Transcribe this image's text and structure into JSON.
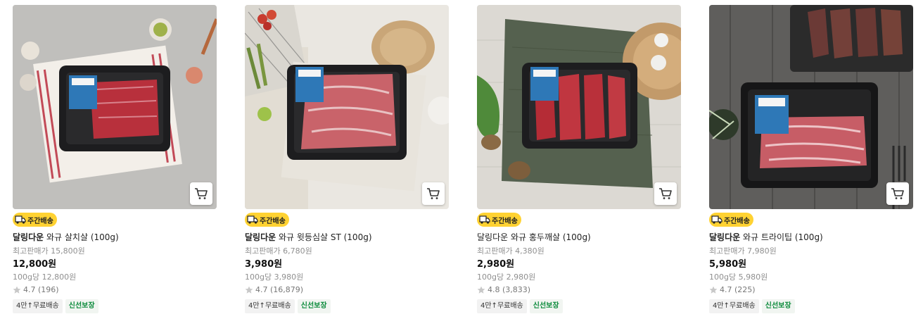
{
  "products": [
    {
      "badge": "주간배송",
      "brand": "달링다운",
      "name": " 와규 살치살 (100g)",
      "orig_price": "최고판매가 15,800원",
      "price": "12,800원",
      "unit_price": "100g당 12,800원",
      "rating": "4.7 (196)",
      "tags": [
        "4만↑무료배송",
        "신선보장"
      ],
      "brand_bold": true
    },
    {
      "badge": "주간배송",
      "brand": "달링다운",
      "name": " 와규 윗등심살 ST (100g)",
      "orig_price": "최고판매가 6,780원",
      "price": "3,980원",
      "unit_price": "100g당 3,980원",
      "rating": "4.7 (16,879)",
      "tags": [
        "4만↑무료배송",
        "신선보장"
      ],
      "brand_bold": true
    },
    {
      "badge": "주간배송",
      "brand": "달링다운",
      "name": " 와규 홍두깨살 (100g)",
      "orig_price": "최고판매가 4,380원",
      "price": "2,980원",
      "unit_price": "100g당 2,980원",
      "rating": "4.8 (3,833)",
      "tags": [
        "4만↑무료배송",
        "신선보장"
      ],
      "brand_bold": false
    },
    {
      "badge": "주간배송",
      "brand": "달링다운",
      "name": " 와규 트라이팁 (100g)",
      "orig_price": "최고판매가 7,980원",
      "price": "5,980원",
      "unit_price": "100g당 5,980원",
      "rating": "4.7 (225)",
      "tags": [
        "4만↑무료배송",
        "신선보장"
      ],
      "brand_bold": true
    }
  ],
  "colors": {
    "badge_bg": "#ffd232",
    "fresh_tag": "#0a8a3a",
    "star": "#c8c8c8",
    "meat": "#b8303c",
    "label_blue": "#2e78b7"
  },
  "icons": {
    "cart": "cart-icon",
    "truck": "truck-icon",
    "star": "star-icon"
  }
}
